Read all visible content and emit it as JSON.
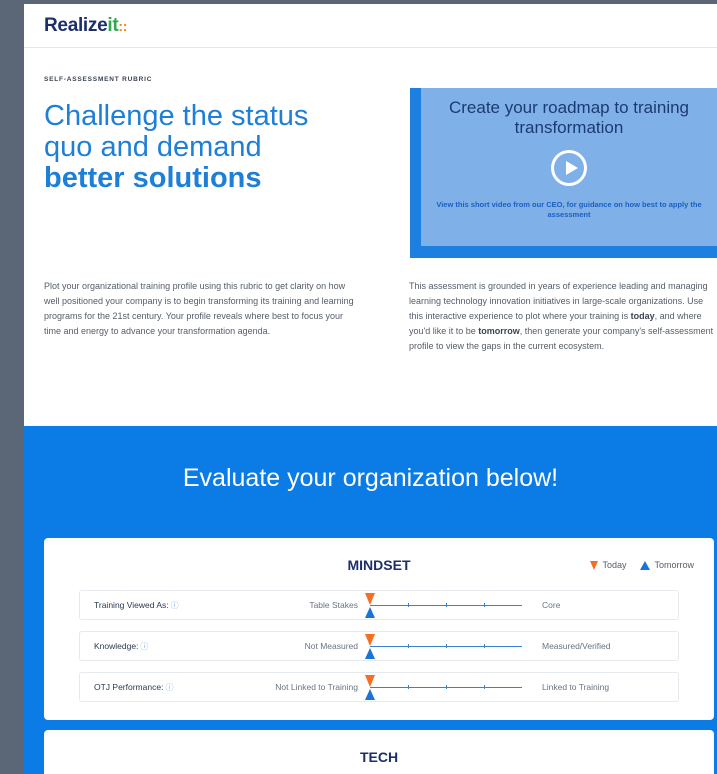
{
  "brand": {
    "logo_main": "Realize",
    "logo_it": "it",
    "logo_dots": "::"
  },
  "hero": {
    "eyebrow": "SELF-ASSESSMENT RUBRIC",
    "headline_plain": "Challenge the status quo and demand ",
    "headline_bold": "better solutions",
    "intro_left": "Plot your organizational training profile using this rubric to get clarity on how well positioned your company is to begin transforming its training and learning programs for the 21st century. Your profile reveals where best to focus your time and energy to advance your transformation agenda.",
    "intro_right_1": "This assessment is grounded in years of experience leading and managing learning technology innovation initiatives in large-scale organizations. Use this interactive experience to plot where your training is ",
    "intro_right_today": "today",
    "intro_right_2": ", and where you'd like it to be ",
    "intro_right_tomorrow": "tomorrow",
    "intro_right_3": ", then generate your company's self-assessment profile to view the gaps in the current ecosystem."
  },
  "video": {
    "title": "Create your roadmap to training transformation",
    "caption": "View this short video from our CEO, for guidance on how best to apply the assessment",
    "play_icon": "play-circle-icon"
  },
  "evaluate": {
    "title": "Evaluate your organization below!",
    "legend": {
      "today": "Today",
      "tomorrow": "Tomorrow"
    },
    "sections": [
      {
        "title": "MINDSET",
        "rows": [
          {
            "label": "Training Viewed As:",
            "left": "Table Stakes",
            "right": "Core",
            "today": 0,
            "tomorrow": 0
          },
          {
            "label": "Knowledge:",
            "left": "Not Measured",
            "right": "Measured/Verified",
            "today": 0,
            "tomorrow": 0
          },
          {
            "label": "OTJ Performance:",
            "left": "Not Linked to Training",
            "right": "Linked to Training",
            "today": 0,
            "tomorrow": 0
          }
        ]
      },
      {
        "title": "TECH"
      }
    ]
  },
  "colors": {
    "accent": "#0b7be6",
    "today": "#f36f21",
    "tomorrow": "#1a73d9",
    "headline": "#1e7fd6"
  }
}
